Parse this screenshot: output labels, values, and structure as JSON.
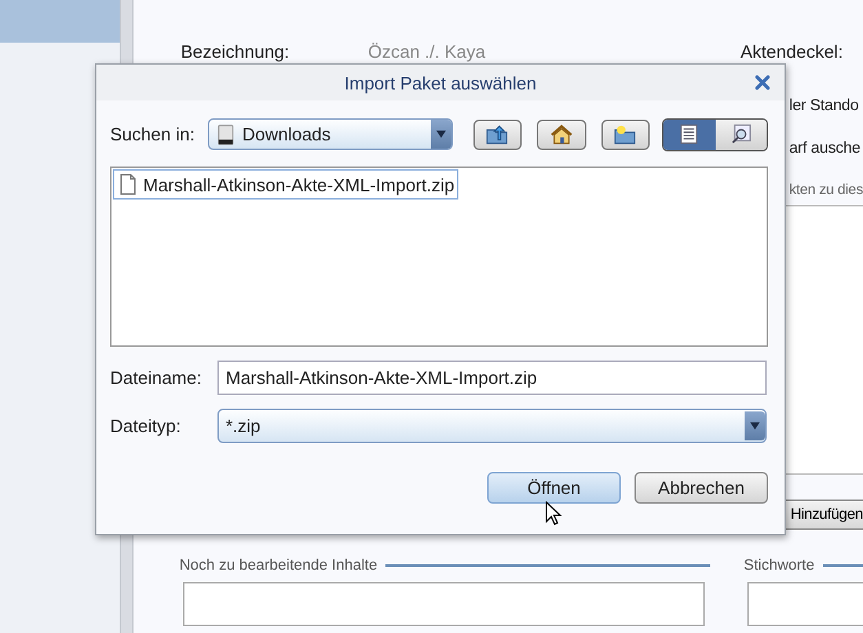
{
  "sidebar": {
    "items": [
      {
        "selected": true
      }
    ]
  },
  "form": {
    "label": "Bezeichnung:",
    "value": "Özcan ./. Kaya",
    "right_label": "Aktendeckel:",
    "right_fragments": [
      "ler Stando",
      "arf ausche"
    ],
    "list_caption": "kten zu dies"
  },
  "actions": [
    {
      "label": "Hinzufügen"
    }
  ],
  "sections": [
    {
      "title": "Noch zu bearbeitende Inhalte"
    },
    {
      "title": "Stichworte"
    }
  ],
  "dialog": {
    "title": "Import Paket auswählen",
    "look_in": {
      "label": "Suchen in:",
      "value": "Downloads"
    },
    "toolbar": [
      {
        "kind": "up"
      },
      {
        "kind": "home"
      },
      {
        "kind": "new-folder"
      },
      {
        "kind": "list",
        "selected": true
      },
      {
        "kind": "details",
        "selected": false
      }
    ],
    "files": [
      {
        "name": "Marshall-Atkinson-Akte-XML-Import.zip",
        "selected": true
      }
    ],
    "file_name": {
      "label": "Dateiname:",
      "value": "Marshall-Atkinson-Akte-XML-Import.zip"
    },
    "file_type": {
      "label": "Dateityp:",
      "value": "*.zip"
    },
    "buttons": [
      {
        "label": "Öffnen",
        "default": true
      },
      {
        "label": "Abbrechen",
        "default": false
      }
    ]
  }
}
